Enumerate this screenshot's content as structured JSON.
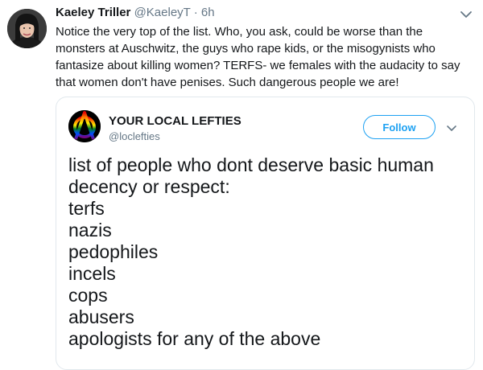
{
  "tweet": {
    "author_name": "Kaeley Triller",
    "author_handle": "@KaeleyT",
    "separator": " · ",
    "time": "6h",
    "text": "Notice the very top of the list. Who, you ask, could be worse than the monsters at Auschwitz, the guys who rape kids, or the misogynists who fantasize about killing women? TERFS- we females with the audacity to say that women don't have penises. Such dangerous people we are!"
  },
  "quoted": {
    "author_name": "YOUR LOCAL LEFTIES",
    "author_handle": "@loclefties",
    "follow_label": "Follow",
    "lines": [
      "list of people who dont deserve basic human",
      "decency or respect:",
      "terfs",
      "nazis",
      "pedophiles",
      "incels",
      "cops",
      "abusers",
      "apologists for any of the above"
    ]
  },
  "colors": {
    "accent": "#1da1f2",
    "secondary_text": "#657786",
    "border": "#e1e8ed"
  },
  "icons": [
    "chevron-down-icon",
    "anarchy-rainbow-logo"
  ]
}
